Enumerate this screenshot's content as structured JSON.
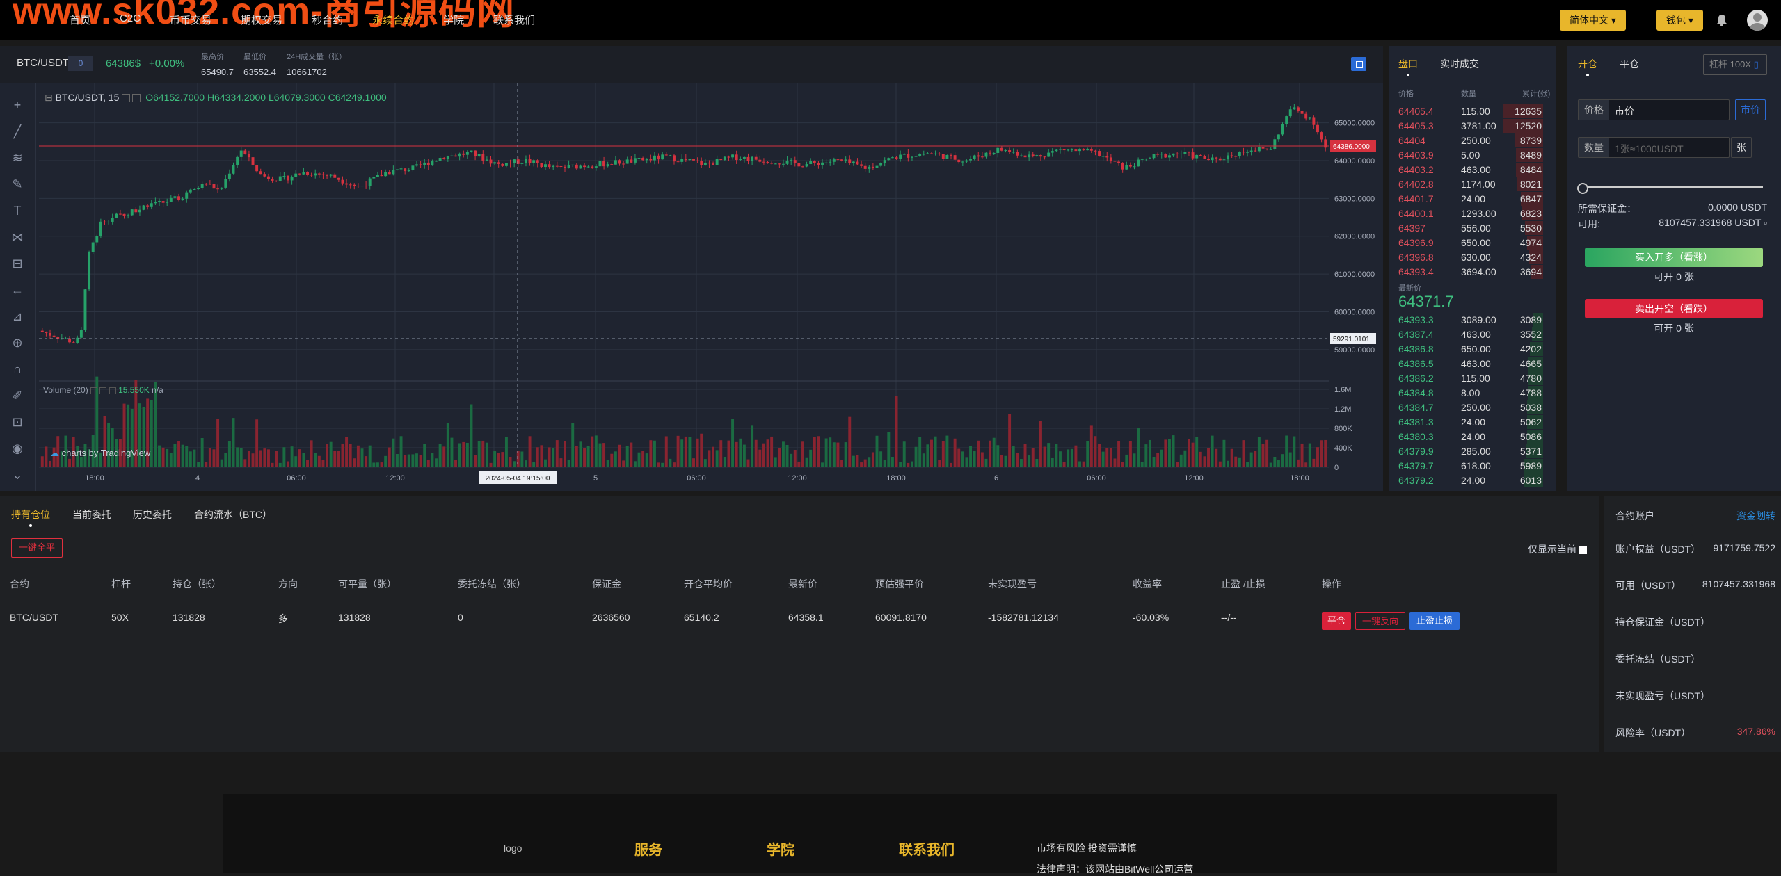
{
  "header": {
    "watermark": "www.sk032.com-商引源码网",
    "nav": [
      "首页",
      "C2C",
      "币币交易",
      "期权交易",
      "秒合约",
      "永续合约",
      "学院",
      "联系我们"
    ],
    "active_index": 5,
    "lang_label": "简体中文",
    "wallet_label": "钱包",
    "accent": "#e8b62b"
  },
  "ticker": {
    "symbol": "BTC/USDT",
    "box": "0",
    "price": "64386$",
    "change": "+0.00%",
    "high_label": "最高价",
    "high": "65490.7",
    "low_label": "最低价",
    "low": "63552.4",
    "vol_label": "24H成交量（张）",
    "vol": "10661702"
  },
  "chart_data": {
    "type": "candlestick",
    "title": "BTC/USDT, 15",
    "ohlc_labels": {
      "o": "O64152.7000",
      "h": "H64334.2000",
      "l": "L64079.3000",
      "c": "C64249.1000"
    },
    "volume_label": "Volume (20)",
    "volume_value": "15.550K",
    "volume_na": "n/a",
    "watermark": "charts by TradingView",
    "y_ticks": [
      "65000.0000",
      "64000.0000",
      "63000.0000",
      "62000.0000",
      "61000.0000",
      "60000.0000",
      "59000.0000"
    ],
    "y_range": [
      58500,
      65600
    ],
    "vol_ticks": [
      "1.6M",
      "1.2M",
      "800K",
      "400K",
      "0"
    ],
    "x_ticks": [
      "18:00",
      "4",
      "06:00",
      "12:00",
      "2024-05-04 19:15:00",
      "5",
      "06:00",
      "12:00",
      "18:00",
      "6",
      "06:00",
      "12:00",
      "18:00"
    ],
    "current_price_badge": "64386.0000",
    "crosshair_price_badge": "59291.0101",
    "crosshair_value": 59291,
    "current_value": 64386,
    "up_color": "#26a269",
    "down_color": "#d6323f"
  },
  "orderbook": {
    "tabs": [
      "盘口",
      "实时成交"
    ],
    "headers": [
      "价格",
      "数量",
      "累计(张)"
    ],
    "asks": [
      [
        "64405.4",
        "115.00",
        "12635"
      ],
      [
        "64405.3",
        "3781.00",
        "12520"
      ],
      [
        "64404",
        "250.00",
        "8739"
      ],
      [
        "64403.9",
        "5.00",
        "8489"
      ],
      [
        "64403.2",
        "463.00",
        "8484"
      ],
      [
        "64402.8",
        "1174.00",
        "8021"
      ],
      [
        "64401.7",
        "24.00",
        "6847"
      ],
      [
        "64400.1",
        "1293.00",
        "6823"
      ],
      [
        "64397",
        "556.00",
        "5530"
      ],
      [
        "64396.9",
        "650.00",
        "4974"
      ],
      [
        "64396.8",
        "630.00",
        "4324"
      ],
      [
        "64393.4",
        "3694.00",
        "3694"
      ]
    ],
    "last_label": "最新价",
    "last_price": "64371.7",
    "bids": [
      [
        "64393.3",
        "3089.00",
        "3089"
      ],
      [
        "64387.4",
        "463.00",
        "3552"
      ],
      [
        "64386.8",
        "650.00",
        "4202"
      ],
      [
        "64386.5",
        "463.00",
        "4665"
      ],
      [
        "64386.2",
        "115.00",
        "4780"
      ],
      [
        "64384.8",
        "8.00",
        "4788"
      ],
      [
        "64384.7",
        "250.00",
        "5038"
      ],
      [
        "64381.3",
        "24.00",
        "5062"
      ],
      [
        "64380.3",
        "24.00",
        "5086"
      ],
      [
        "64379.9",
        "285.00",
        "5371"
      ],
      [
        "64379.7",
        "618.00",
        "5989"
      ],
      [
        "64379.2",
        "24.00",
        "6013"
      ]
    ]
  },
  "trade": {
    "tabs": [
      "开仓",
      "平仓"
    ],
    "leverage": "杠杆 100X",
    "price_label": "价格",
    "price_value": "市价",
    "market_btn": "市价",
    "qty_label": "数量",
    "qty_placeholder": "1张≈1000USDT",
    "qty_unit": "张",
    "margin_label": "所需保证金：",
    "margin_value": "0.0000 USDT",
    "avail_label": "可用:",
    "avail_value": "8107457.331968 USDT",
    "buy_label": "买入开多（看涨）",
    "buy_can": "可开 0 张",
    "sell_label": "卖出开空（看跌）",
    "sell_can": "可开 0 张"
  },
  "positions": {
    "tabs": [
      "持有仓位",
      "当前委托",
      "历史委托",
      "合约流水（BTC）"
    ],
    "close_all": "一键全平",
    "only_current": "仅显示当前",
    "headers": [
      "合约",
      "杠杆",
      "持仓（张）",
      "方向",
      "可平量（张）",
      "委托冻结（张）",
      "保证金",
      "开仓平均价",
      "最新价",
      "预估强平价",
      "未实现盈亏",
      "收益率",
      "止盈 /止损",
      "操作"
    ],
    "row": [
      "BTC/USDT",
      "50X",
      "131828",
      "多",
      "131828",
      "0",
      "2636560",
      "65140.2",
      "64358.1",
      "60091.8170",
      "-1582781.12134",
      "-60.03%",
      "--/--"
    ],
    "actions": [
      "平仓",
      "一键反向",
      "止盈止损"
    ]
  },
  "account": {
    "title": "合约账户",
    "transfer": "资金划转",
    "rows": [
      [
        "账户权益（USDT）",
        "9171759.7522"
      ],
      [
        "可用（USDT）",
        "8107457.331968"
      ],
      [
        "持仓保证金（USDT）",
        ""
      ],
      [
        "委托冻结（USDT）",
        ""
      ],
      [
        "未实现盈亏（USDT）",
        ""
      ],
      [
        "风险率（USDT）",
        "347.86%"
      ]
    ]
  },
  "footer": {
    "logo_alt": "logo",
    "headings": [
      "服务",
      "学院",
      "联系我们"
    ],
    "risk": "市场有风险 投资需谨慎",
    "legal": "法律声明：该网站由BitWell公司运营"
  }
}
